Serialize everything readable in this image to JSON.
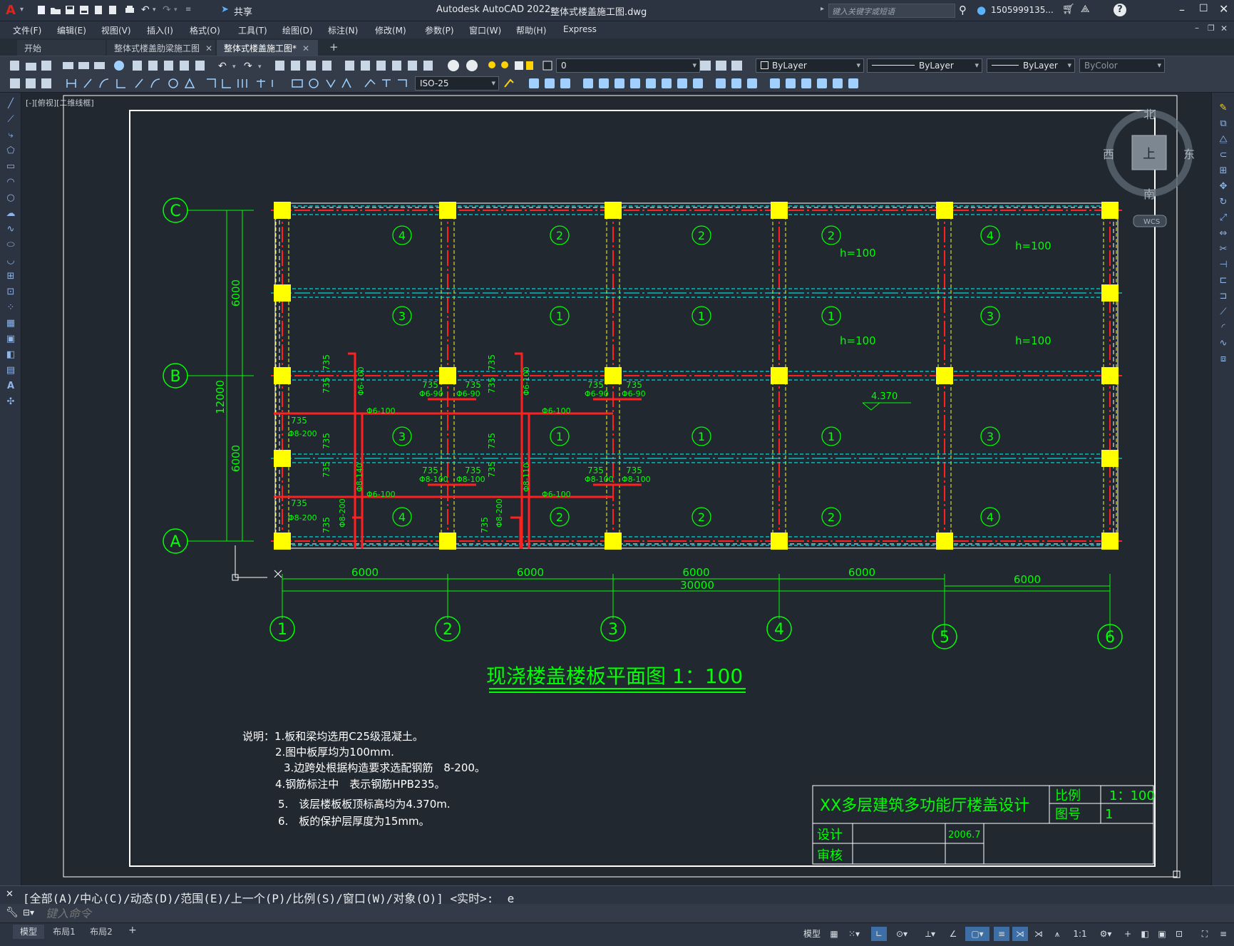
{
  "app": {
    "logo": "A",
    "title": "Autodesk AutoCAD 2022",
    "filename": "整体式楼盖施工图.dwg",
    "share_label": "共享",
    "search_placeholder": "键入关键字或短语",
    "user": "1505999135...",
    "help_icon": "?"
  },
  "menu": [
    "文件(F)",
    "编辑(E)",
    "视图(V)",
    "插入(I)",
    "格式(O)",
    "工具(T)",
    "绘图(D)",
    "标注(N)",
    "修改(M)",
    "参数(P)",
    "窗口(W)",
    "帮助(H)",
    "Express"
  ],
  "tabs": [
    {
      "label": "开始",
      "closable": false,
      "active": false
    },
    {
      "label": "整体式楼盖肋梁施工图",
      "closable": true,
      "active": false
    },
    {
      "label": "整体式楼盖施工图*",
      "closable": true,
      "active": true
    }
  ],
  "layer_value": "0",
  "properties": {
    "color": "ByLayer",
    "linetype": "ByLayer",
    "lineweight": "ByLayer",
    "plotstyle": "ByColor"
  },
  "dimstyle": "ISO-25",
  "viewport_label": "[-][俯视][二维线框]",
  "viewcube": {
    "north": "北",
    "south": "南",
    "east": "东",
    "west": "西",
    "top": "上",
    "wcs": "WCS"
  },
  "drawing": {
    "axis_rows": [
      "C",
      "B",
      "A"
    ],
    "axis_cols": [
      "1",
      "2",
      "3",
      "4",
      "5",
      "6"
    ],
    "spans_x": [
      "6000",
      "6000",
      "6000",
      "6000",
      "6000"
    ],
    "total_x": "30000",
    "spans_y": [
      "6000",
      "6000"
    ],
    "total_y": "12000",
    "slab_row1": [
      "4",
      "2",
      "2",
      "2",
      "4"
    ],
    "slab_row2": [
      "3",
      "1",
      "1",
      "1",
      "3"
    ],
    "slab_row3": [
      "3",
      "1",
      "1",
      "1",
      "3"
    ],
    "slab_row4": [
      "4",
      "2",
      "2",
      "2",
      "4"
    ],
    "slab_thickness": "h=100",
    "elevation": "4.370",
    "rebar_labels": [
      "Φ6-100",
      "Φ8-200",
      "Φ8-140",
      "Φ6-90",
      "Φ8-110",
      "Φ8-100",
      "735"
    ],
    "title": "现浇楼盖楼板平面图 1：100",
    "notes": [
      "说明：1.板和梁均选用C25级混凝土。",
      "2.图中板厚均为100mm.",
      "3.边跨处根据构造要求选配钢筋　8-200。",
      "4.钢筋标注中　表示钢筋HPB235。",
      "5.　该层楼板板顶标高均为4.370m.",
      "6.　板的保护层厚度为15mm。"
    ],
    "titleblock": {
      "project": "XX多层建筑多功能厅楼盖设计",
      "scale_label": "比例",
      "scale_value": "1：100",
      "sheet_label": "图号",
      "sheet_value": "1",
      "design_label": "设计",
      "date": "2006.7",
      "review_label": "审核"
    }
  },
  "command": {
    "history": "[全部(A)/中心(C)/动态(D)/范围(E)/上一个(P)/比例(S)/窗口(W)/对象(O)] <实时>: _e",
    "placeholder": "键入命令"
  },
  "layout_tabs": [
    "模型",
    "布局1",
    "布局2"
  ],
  "status": {
    "model": "模型",
    "scale": "1:1"
  },
  "colors": {
    "bg": "#212830",
    "green": "#00ff00",
    "red": "#ff2020",
    "yellow": "#ffff00",
    "cyan": "#00ffff",
    "white": "#ffffff"
  }
}
